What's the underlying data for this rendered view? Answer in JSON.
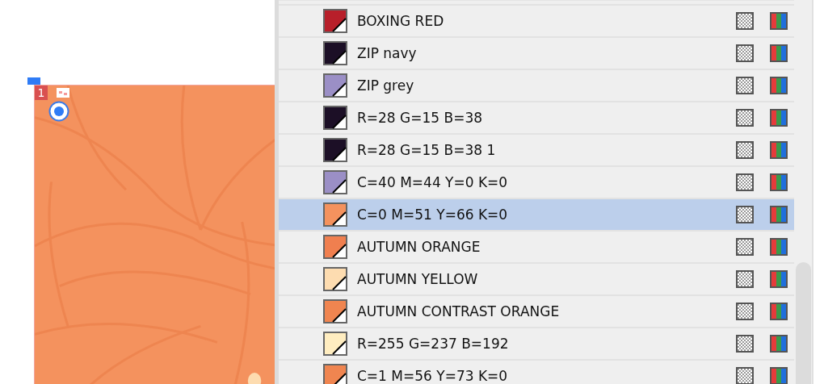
{
  "canvas": {
    "page_number": "1"
  },
  "swatches": [
    {
      "name": "BOXING RED",
      "color": "#b81f2a",
      "selected": false
    },
    {
      "name": "ZIP navy",
      "color": "#1c0f26",
      "selected": false
    },
    {
      "name": "ZIP grey",
      "color": "#9b8fc6",
      "selected": false
    },
    {
      "name": "R=28 G=15 B=38",
      "color": "#1c0f26",
      "selected": false
    },
    {
      "name": "R=28 G=15 B=38 1",
      "color": "#1c0f26",
      "selected": false
    },
    {
      "name": "C=40 M=44 Y=0 K=0",
      "color": "#9b8fc6",
      "selected": false
    },
    {
      "name": "C=0 M=51 Y=66 K=0",
      "color": "#f4925e",
      "selected": true
    },
    {
      "name": "AUTUMN ORANGE",
      "color": "#f07f4f",
      "selected": false
    },
    {
      "name": "AUTUMN YELLOW",
      "color": "#fddcb0",
      "selected": false
    },
    {
      "name": "AUTUMN CONTRAST ORANGE",
      "color": "#f08550",
      "selected": false
    },
    {
      "name": "R=255 G=237 B=192",
      "color": "#ffedc0",
      "selected": false
    },
    {
      "name": "C=1 M=56 Y=73 K=0",
      "color": "#f08550",
      "selected": false
    }
  ]
}
